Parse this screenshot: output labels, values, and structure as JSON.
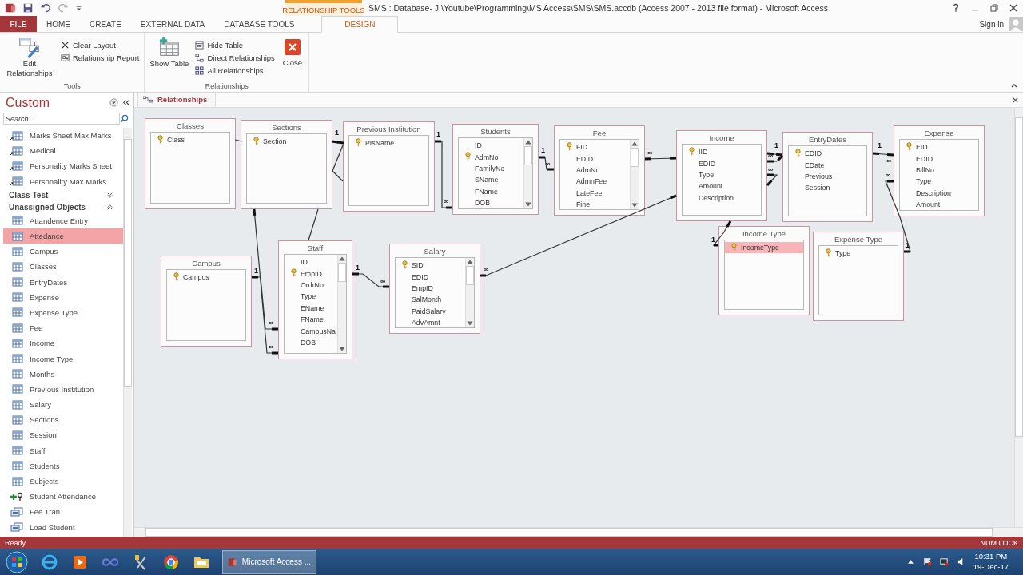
{
  "title_bar": {
    "context_label": "RELATIONSHIP TOOLS",
    "title": "SMS : Database- J:\\Youtube\\Programming\\MS Access\\SMS\\SMS.accdb (Access 2007 - 2013 file format) - Microsoft Access",
    "sign_in": "Sign in"
  },
  "ribbon": {
    "tabs": [
      {
        "label": "FILE",
        "kind": "file",
        "selected": false
      },
      {
        "label": "HOME",
        "kind": "tab",
        "selected": false
      },
      {
        "label": "CREATE",
        "kind": "tab",
        "selected": false
      },
      {
        "label": "EXTERNAL DATA",
        "kind": "tab",
        "selected": false
      },
      {
        "label": "DATABASE TOOLS",
        "kind": "tab",
        "selected": false
      },
      {
        "label": "DESIGN",
        "kind": "context",
        "selected": true
      }
    ],
    "groups": [
      {
        "label": "Tools",
        "buttons": [
          {
            "label": "Edit Relationships",
            "kind": "large"
          },
          {
            "label": "Clear Layout",
            "kind": "small"
          },
          {
            "label": "Relationship Report",
            "kind": "small"
          }
        ]
      },
      {
        "label": "Relationships",
        "buttons": [
          {
            "label": "Show Table",
            "kind": "large"
          },
          {
            "label": "Hide Table",
            "kind": "small"
          },
          {
            "label": "Direct Relationships",
            "kind": "small"
          },
          {
            "label": "All Relationships",
            "kind": "small"
          },
          {
            "label": "Close",
            "kind": "large"
          }
        ]
      }
    ]
  },
  "nav_pane": {
    "title": "Custom",
    "search": {
      "placeholder": "Search..."
    },
    "groups": [
      {
        "items": [
          {
            "label": "Marks Sheet Max Marks",
            "kind": "linked",
            "selected": false
          },
          {
            "label": "Medical",
            "kind": "linked",
            "selected": false
          },
          {
            "label": "Personality Marks Sheet",
            "kind": "linked",
            "selected": false
          },
          {
            "label": "Personality Max Marks",
            "kind": "linked",
            "selected": false
          }
        ]
      },
      {
        "title": "Class Test",
        "expanded": false
      },
      {
        "title": "Unassigned Objects",
        "expanded": true,
        "items": [
          {
            "label": "Attandence Entry",
            "kind": "table",
            "selected": false
          },
          {
            "label": "Attedance",
            "kind": "table",
            "selected": true
          },
          {
            "label": "Campus",
            "kind": "table",
            "selected": false
          },
          {
            "label": "Classes",
            "kind": "table",
            "selected": false
          },
          {
            "label": "EntryDates",
            "kind": "table",
            "selected": false
          },
          {
            "label": "Expense",
            "kind": "table",
            "selected": false
          },
          {
            "label": "Expense Type",
            "kind": "table",
            "selected": false
          },
          {
            "label": "Fee",
            "kind": "table",
            "selected": false
          },
          {
            "label": "Income",
            "kind": "table",
            "selected": false
          },
          {
            "label": "Income Type",
            "kind": "table",
            "selected": false
          },
          {
            "label": "Months",
            "kind": "table",
            "selected": false
          },
          {
            "label": "Previous Institution",
            "kind": "table",
            "selected": false
          },
          {
            "label": "Salary",
            "kind": "table",
            "selected": false
          },
          {
            "label": "Sections",
            "kind": "table",
            "selected": false
          },
          {
            "label": "Session",
            "kind": "table",
            "selected": false
          },
          {
            "label": "Staff",
            "kind": "table",
            "selected": false
          },
          {
            "label": "Students",
            "kind": "table",
            "selected": false
          },
          {
            "label": "Subjects",
            "kind": "table",
            "selected": false
          },
          {
            "label": "Student Attendance",
            "kind": "query",
            "selected": false
          },
          {
            "label": "Fee Tran",
            "kind": "form",
            "selected": false
          },
          {
            "label": "Load Student",
            "kind": "form",
            "selected": false
          }
        ]
      }
    ]
  },
  "document_tab": {
    "label": "Relationships"
  },
  "diagram": {
    "tables": [
      {
        "name": "Classes",
        "fields": [
          {
            "name": "Class",
            "key": true,
            "selected": false
          }
        ]
      },
      {
        "name": "Sections",
        "fields": [
          {
            "name": "Section",
            "key": true,
            "selected": false
          }
        ]
      },
      {
        "name": "Previous Institution",
        "fields": [
          {
            "name": "PIsName",
            "key": true,
            "selected": false
          }
        ]
      },
      {
        "name": "Students",
        "fields": [
          {
            "name": "ID",
            "key": false,
            "selected": false
          },
          {
            "name": "AdmNo",
            "key": true,
            "selected": false
          },
          {
            "name": "FamilyNo",
            "key": false,
            "selected": false
          },
          {
            "name": "SName",
            "key": false,
            "selected": false
          },
          {
            "name": "FName",
            "key": false,
            "selected": false
          },
          {
            "name": "DOB",
            "key": false,
            "selected": false
          }
        ]
      },
      {
        "name": "Fee",
        "fields": [
          {
            "name": "FID",
            "key": true,
            "selected": false
          },
          {
            "name": "EDID",
            "key": false,
            "selected": false
          },
          {
            "name": "AdmNo",
            "key": false,
            "selected": false
          },
          {
            "name": "AdmnFee",
            "key": false,
            "selected": false
          },
          {
            "name": "LateFee",
            "key": false,
            "selected": false
          },
          {
            "name": "Fine",
            "key": false,
            "selected": false
          }
        ]
      },
      {
        "name": "Income",
        "fields": [
          {
            "name": "IID",
            "key": true,
            "selected": false
          },
          {
            "name": "EDID",
            "key": false,
            "selected": false
          },
          {
            "name": "Type",
            "key": false,
            "selected": false
          },
          {
            "name": "Amount",
            "key": false,
            "selected": false
          },
          {
            "name": "Description",
            "key": false,
            "selected": false
          }
        ]
      },
      {
        "name": "EntryDates",
        "fields": [
          {
            "name": "EDID",
            "key": true,
            "selected": false
          },
          {
            "name": "EDate",
            "key": false,
            "selected": false
          },
          {
            "name": "Previous",
            "key": false,
            "selected": false
          },
          {
            "name": "Session",
            "key": false,
            "selected": false
          }
        ]
      },
      {
        "name": "Expense",
        "fields": [
          {
            "name": "EID",
            "key": true,
            "selected": false
          },
          {
            "name": "EDID",
            "key": false,
            "selected": false
          },
          {
            "name": "BillNo",
            "key": false,
            "selected": false
          },
          {
            "name": "Type",
            "key": false,
            "selected": false
          },
          {
            "name": "Description",
            "key": false,
            "selected": false
          },
          {
            "name": "Amount",
            "key": false,
            "selected": false
          }
        ]
      },
      {
        "name": "Campus",
        "fields": [
          {
            "name": "Campus",
            "key": true,
            "selected": false
          }
        ]
      },
      {
        "name": "Staff",
        "fields": [
          {
            "name": "ID",
            "key": false,
            "selected": false
          },
          {
            "name": "EmpID",
            "key": true,
            "selected": false
          },
          {
            "name": "OrdrNo",
            "key": false,
            "selected": false
          },
          {
            "name": "Type",
            "key": false,
            "selected": false
          },
          {
            "name": "EName",
            "key": false,
            "selected": false
          },
          {
            "name": "FName",
            "key": false,
            "selected": false
          },
          {
            "name": "CampusNa",
            "key": false,
            "selected": false
          },
          {
            "name": "DOB",
            "key": false,
            "selected": false
          }
        ]
      },
      {
        "name": "Salary",
        "fields": [
          {
            "name": "SID",
            "key": true,
            "selected": false
          },
          {
            "name": "EDID",
            "key": false,
            "selected": false
          },
          {
            "name": "EmpID",
            "key": false,
            "selected": false
          },
          {
            "name": "SalMonth",
            "key": false,
            "selected": false
          },
          {
            "name": "PaidSalary",
            "key": false,
            "selected": false
          },
          {
            "name": "AdvAmnt",
            "key": false,
            "selected": false
          }
        ]
      },
      {
        "name": "Income Type",
        "fields": [
          {
            "name": "IncomeType",
            "key": true,
            "selected": true
          }
        ]
      },
      {
        "name": "Expense Type",
        "fields": [
          {
            "name": "Type",
            "key": true,
            "selected": false
          }
        ]
      }
    ],
    "relationships": [
      {
        "enforced": false
      },
      {
        "enforced": true,
        "ends": [
          "1"
        ]
      },
      {
        "enforced": false
      },
      {
        "enforced": false
      },
      {
        "enforced": true,
        "ends": [
          "1",
          "∞"
        ]
      },
      {
        "enforced": true,
        "ends": [
          "1",
          "∞"
        ]
      },
      {
        "enforced": true,
        "ends": [
          "∞"
        ]
      },
      {
        "enforced": true,
        "ends": [
          "∞"
        ]
      },
      {
        "enforced": true,
        "ends": [
          "1"
        ]
      },
      {
        "enforced": true,
        "ends": [
          "∞"
        ]
      },
      {
        "enforced": true,
        "ends": [
          "∞"
        ]
      },
      {
        "enforced": true,
        "ends": [
          "1",
          "∞"
        ]
      },
      {
        "enforced": true,
        "ends": [
          "∞",
          "1"
        ]
      },
      {
        "enforced": true,
        "ends": [
          "1"
        ]
      },
      {
        "enforced": false
      },
      {
        "enforced": true,
        "ends": [
          "∞"
        ]
      },
      {
        "enforced": true,
        "ends": [
          "1",
          "∞"
        ]
      },
      {
        "enforced": true,
        "ends": [
          "1",
          "∞"
        ]
      }
    ]
  },
  "status_bar": {
    "left": "Ready",
    "right": "NUM LOCK"
  },
  "taskbar": {
    "app_button": "Microsoft Access ...",
    "time": "10:31 PM",
    "date": "19-Dec-17"
  }
}
